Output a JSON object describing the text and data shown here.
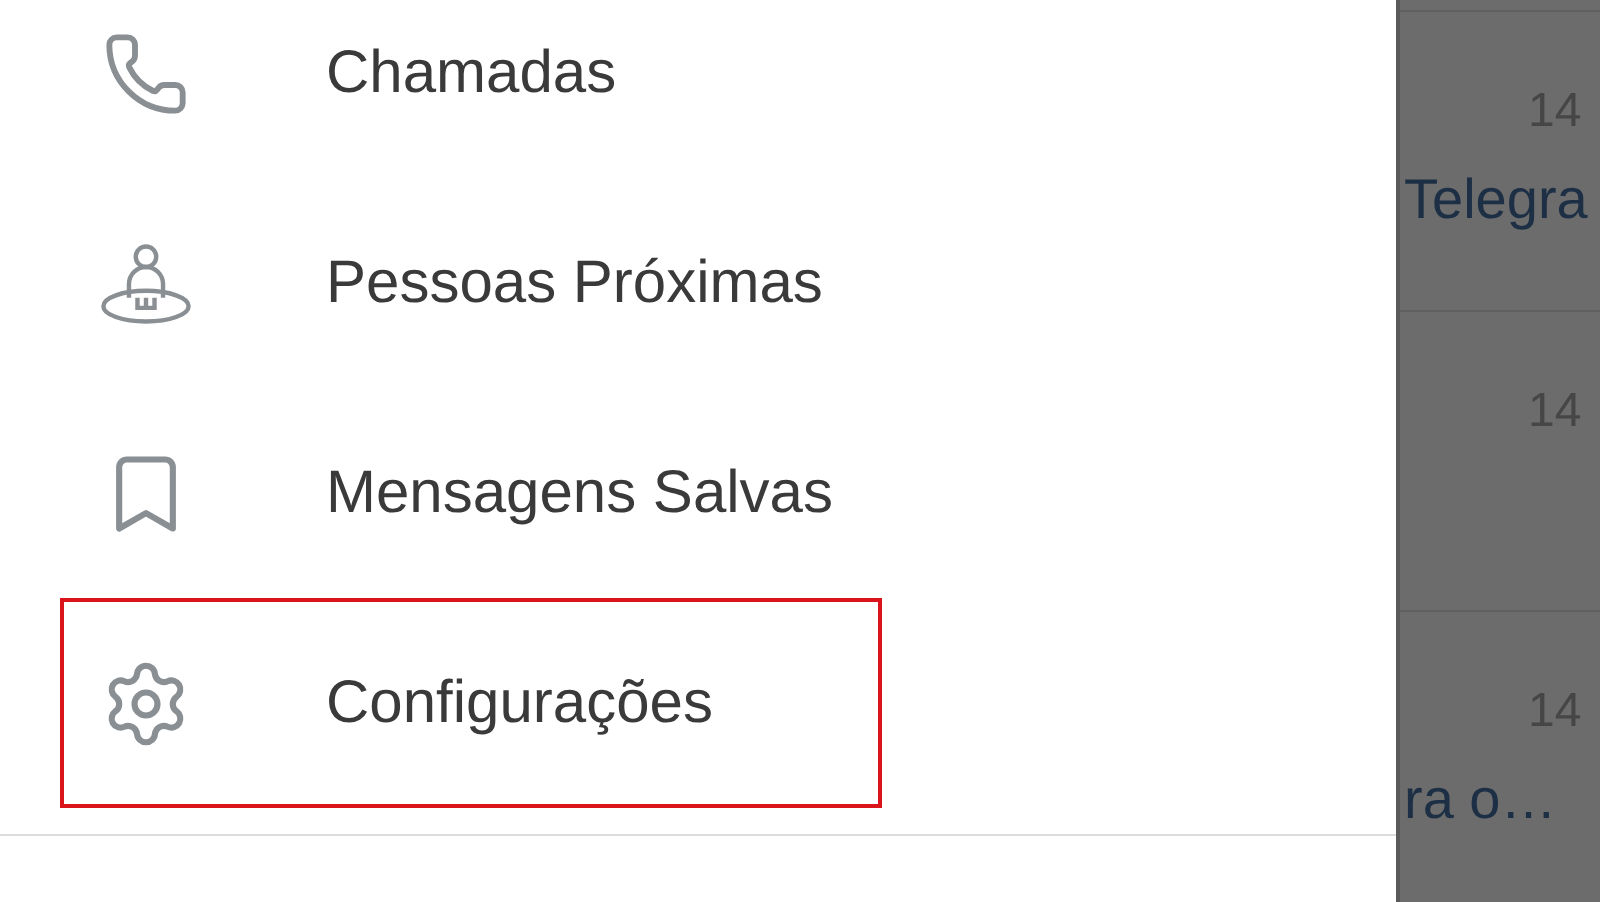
{
  "drawer": {
    "items": [
      {
        "kind": "calls",
        "label": "Chamadas",
        "highlighted": false
      },
      {
        "kind": "nearby",
        "label": "Pessoas Próximas",
        "highlighted": false
      },
      {
        "kind": "saved",
        "label": "Mensagens Salvas",
        "highlighted": false
      },
      {
        "kind": "settings",
        "label": "Configurações",
        "highlighted": true
      }
    ]
  },
  "chat_list": {
    "rows": [
      {
        "time": "14",
        "preview": "Telegra"
      },
      {
        "time": "14"
      },
      {
        "time": "14",
        "preview": "ra o…"
      }
    ]
  }
}
